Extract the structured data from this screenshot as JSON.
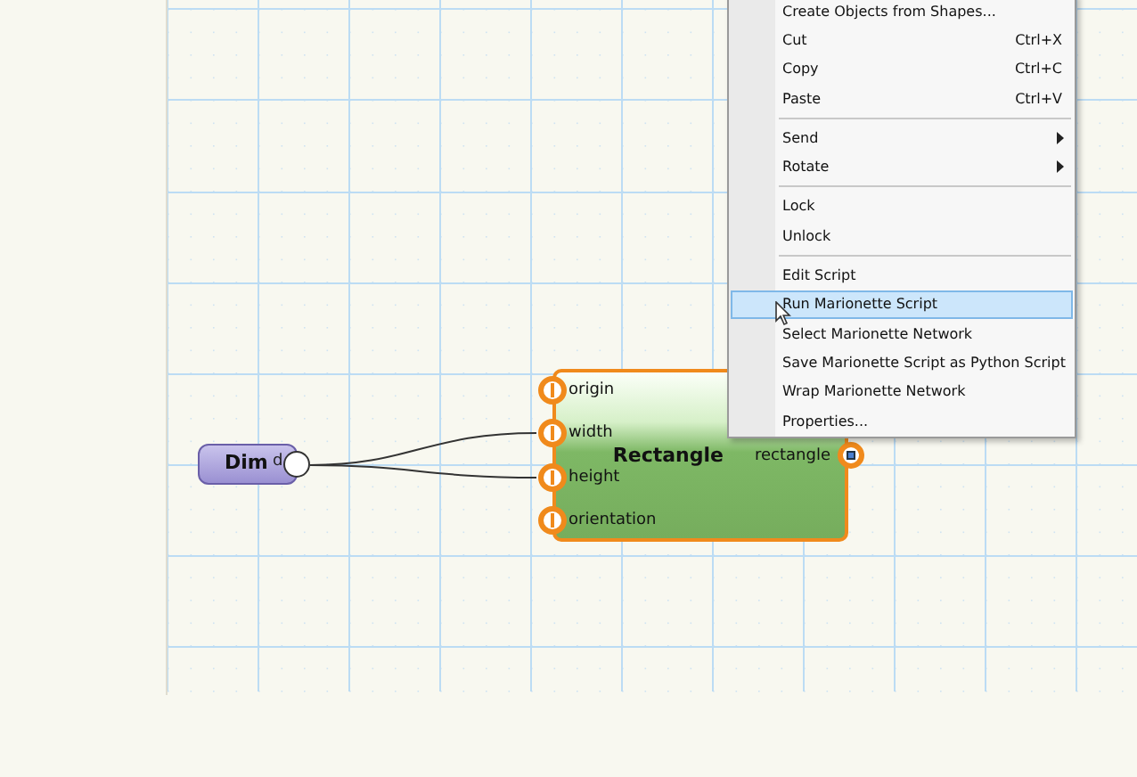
{
  "canvas": {
    "nodes": [
      {
        "kind": "dim",
        "title": "Dim",
        "outputs": [
          "d"
        ]
      },
      {
        "kind": "rectangle",
        "title": "Rectangle",
        "inputs": [
          "origin",
          "width",
          "height",
          "orientation"
        ],
        "outputs": [
          "rectangle"
        ]
      }
    ]
  },
  "context_menu": {
    "items": [
      {
        "kind": "item",
        "label": "Create Objects from Shapes...",
        "submenu": false,
        "selected": false
      },
      {
        "kind": "item",
        "label": "Cut",
        "shortcut": "Ctrl+X",
        "submenu": false,
        "selected": false
      },
      {
        "kind": "item",
        "label": "Copy",
        "shortcut": "Ctrl+C",
        "submenu": false,
        "selected": false
      },
      {
        "kind": "item",
        "label": "Paste",
        "shortcut": "Ctrl+V",
        "submenu": false,
        "selected": false
      },
      {
        "kind": "separator"
      },
      {
        "kind": "item",
        "label": "Send",
        "submenu": true,
        "selected": false
      },
      {
        "kind": "item",
        "label": "Rotate",
        "submenu": true,
        "selected": false
      },
      {
        "kind": "separator"
      },
      {
        "kind": "item",
        "label": "Lock",
        "submenu": false,
        "selected": false
      },
      {
        "kind": "item",
        "label": "Unlock",
        "submenu": false,
        "selected": false
      },
      {
        "kind": "separator"
      },
      {
        "kind": "item",
        "label": "Edit Script",
        "submenu": false,
        "selected": false
      },
      {
        "kind": "item",
        "label": "Run Marionette Script",
        "submenu": false,
        "selected": true
      },
      {
        "kind": "item",
        "label": "Select Marionette Network",
        "submenu": false,
        "selected": false
      },
      {
        "kind": "item",
        "label": "Save Marionette Script as Python Script",
        "submenu": false,
        "selected": false
      },
      {
        "kind": "item",
        "label": "Wrap Marionette Network",
        "submenu": false,
        "selected": false
      },
      {
        "kind": "item",
        "label": "Properties...",
        "submenu": false,
        "selected": false
      }
    ]
  }
}
